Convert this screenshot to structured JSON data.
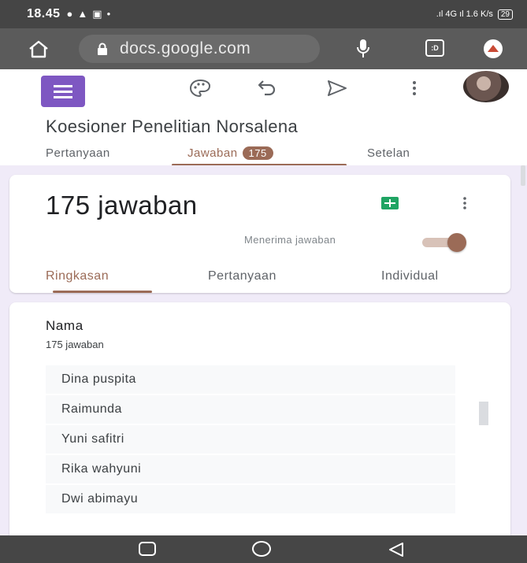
{
  "status_bar": {
    "time": "18.45",
    "notification_icons": [
      "chat-icon",
      "warning-icon",
      "screen-icon",
      "dot-icon"
    ],
    "right_text": ".ıl 4G ıl 1.6 K/s",
    "battery": "29"
  },
  "browser": {
    "url": "docs.google.com",
    "tab_count": ":D"
  },
  "form": {
    "title": "Koesioner Penelitian Norsalena",
    "tabs": {
      "questions": "Pertanyaan",
      "responses": "Jawaban",
      "response_badge": "175",
      "settings": "Setelan"
    }
  },
  "summary": {
    "response_count": "175 jawaban",
    "accepting_label": "Menerima jawaban",
    "accepting": true,
    "subtabs": {
      "summary": "Ringkasan",
      "question": "Pertanyaan",
      "individual": "Individual"
    }
  },
  "question": {
    "title": "Nama",
    "answers_count": "175 jawaban",
    "answers": [
      "Dina puspita",
      "Raimunda",
      "Yuni safitri",
      "Rika wahyuni",
      "Dwi abimayu"
    ]
  },
  "colors": {
    "accent": "#9b6b57",
    "forms_purple": "#7e57c2",
    "sheets_green": "#1fa463",
    "background_tint": "#f0ebf8"
  }
}
